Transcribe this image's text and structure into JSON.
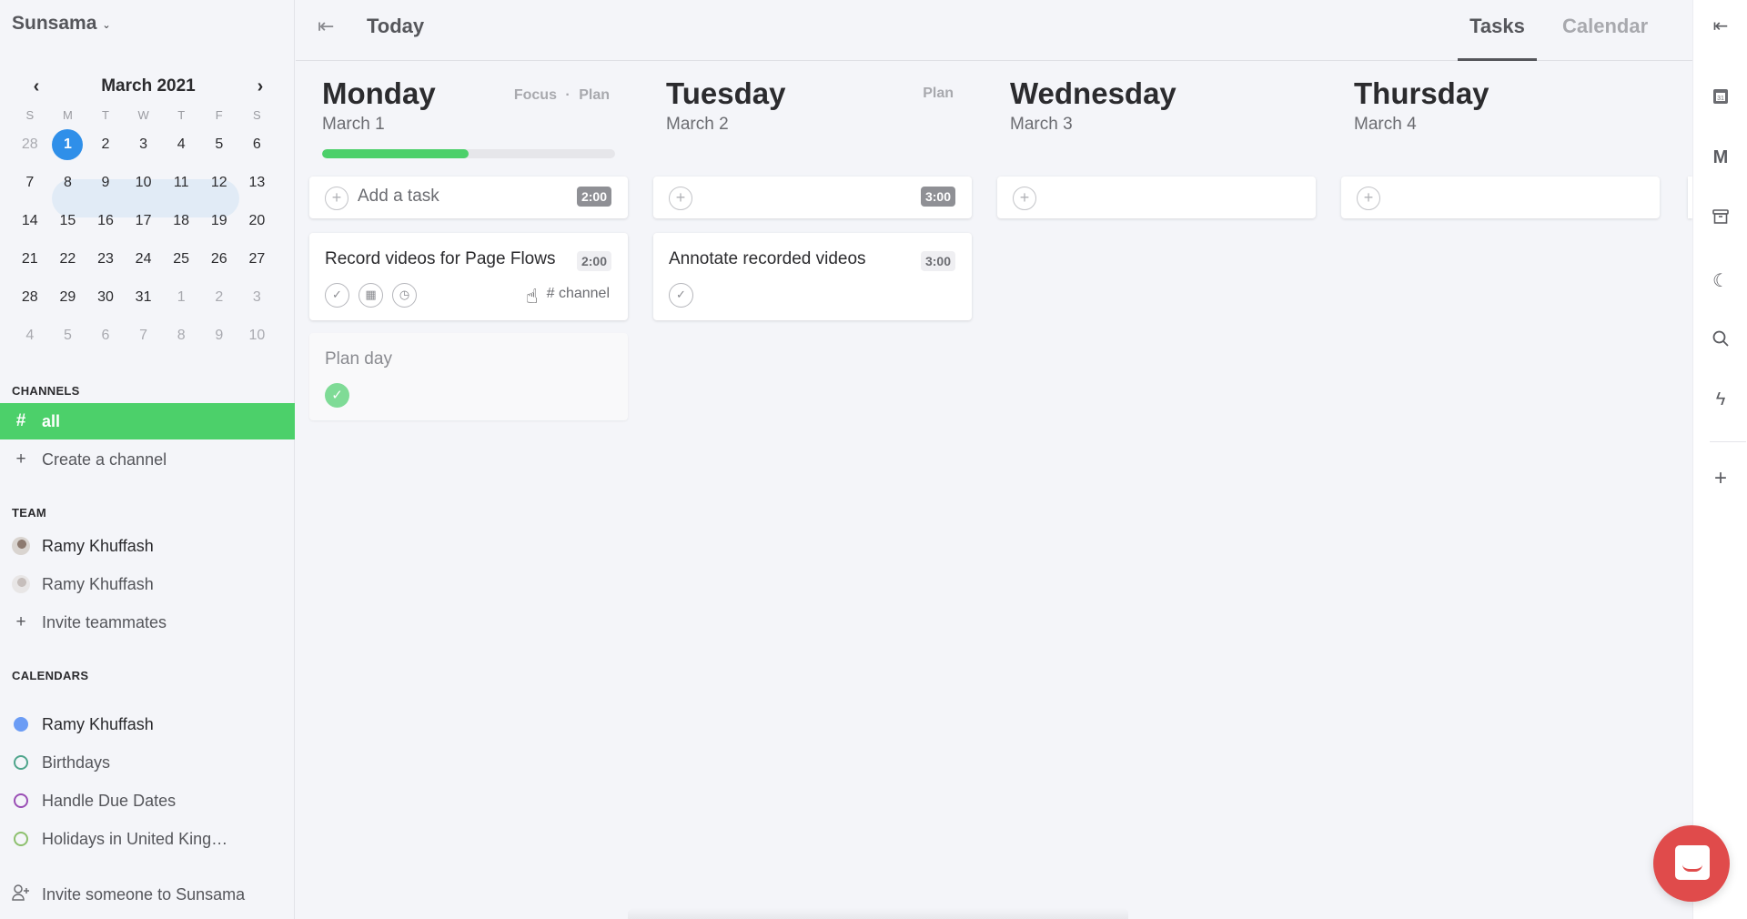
{
  "app": {
    "name": "Sunsama"
  },
  "mini_calendar": {
    "title": "March 2021",
    "prev_label": "‹",
    "next_label": "›",
    "weekdays": [
      "S",
      "M",
      "T",
      "W",
      "T",
      "F",
      "S"
    ],
    "weeks": [
      [
        {
          "d": "28",
          "m": true
        },
        {
          "d": "1",
          "sel": true
        },
        {
          "d": "2"
        },
        {
          "d": "3"
        },
        {
          "d": "4"
        },
        {
          "d": "5"
        },
        {
          "d": "6"
        }
      ],
      [
        {
          "d": "7"
        },
        {
          "d": "8"
        },
        {
          "d": "9"
        },
        {
          "d": "10"
        },
        {
          "d": "11"
        },
        {
          "d": "12"
        },
        {
          "d": "13"
        }
      ],
      [
        {
          "d": "14"
        },
        {
          "d": "15"
        },
        {
          "d": "16"
        },
        {
          "d": "17"
        },
        {
          "d": "18"
        },
        {
          "d": "19"
        },
        {
          "d": "20"
        }
      ],
      [
        {
          "d": "21"
        },
        {
          "d": "22"
        },
        {
          "d": "23"
        },
        {
          "d": "24"
        },
        {
          "d": "25"
        },
        {
          "d": "26"
        },
        {
          "d": "27"
        }
      ],
      [
        {
          "d": "28"
        },
        {
          "d": "29"
        },
        {
          "d": "30"
        },
        {
          "d": "31"
        },
        {
          "d": "1",
          "m": true
        },
        {
          "d": "2",
          "m": true
        },
        {
          "d": "3",
          "m": true
        }
      ],
      [
        {
          "d": "4",
          "m": true
        },
        {
          "d": "5",
          "m": true
        },
        {
          "d": "6",
          "m": true
        },
        {
          "d": "7",
          "m": true
        },
        {
          "d": "8",
          "m": true
        },
        {
          "d": "9",
          "m": true
        },
        {
          "d": "10",
          "m": true
        }
      ]
    ]
  },
  "sidebar": {
    "channels_title": "CHANNELS",
    "channels": [
      {
        "icon": "#",
        "label": "all"
      }
    ],
    "create_channel": "Create a channel",
    "team_title": "TEAM",
    "team": [
      {
        "label": "Ramy Khuffash"
      },
      {
        "label": "Ramy Khuffash"
      }
    ],
    "invite_teammates": "Invite teammates",
    "calendars_title": "CALENDARS",
    "calendars": [
      {
        "label": "Ramy Khuffash",
        "color": "#6b9cf5",
        "filled": true
      },
      {
        "label": "Birthdays",
        "color": "#4fa58c",
        "filled": false
      },
      {
        "label": "Handle Due Dates",
        "color": "#9a4fb5",
        "filled": false
      },
      {
        "label": "Holidays in United King…",
        "color": "#8dc06e",
        "filled": false
      }
    ],
    "invite_someone": "Invite someone to Sunsama"
  },
  "header": {
    "title": "Today",
    "tabs": [
      {
        "label": "Tasks",
        "active": true
      },
      {
        "label": "Calendar",
        "active": false
      }
    ]
  },
  "days": [
    {
      "name": "Monday",
      "date": "March 1",
      "links": [
        "Focus",
        "·",
        "Plan"
      ],
      "progress": 0.5,
      "add_label": "Add a task",
      "total_time": "2:00",
      "tasks": [
        {
          "title": "Record videos for Page Flows",
          "time": "2:00",
          "channel": "# channel"
        }
      ],
      "done_tasks": [
        {
          "title": "Plan day"
        }
      ]
    },
    {
      "name": "Tuesday",
      "date": "March 2",
      "links": [
        "Plan"
      ],
      "add_label": "",
      "total_time": "3:00",
      "tasks": [
        {
          "title": "Annotate recorded videos",
          "time": "3:00"
        }
      ]
    },
    {
      "name": "Wednesday",
      "date": "March 3",
      "links": [],
      "add_label": "",
      "total_time": ""
    },
    {
      "name": "Thursday",
      "date": "March 4",
      "links": [],
      "add_label": "",
      "total_time": ""
    }
  ],
  "colors": {
    "accent_green": "#4cd06a",
    "selected_blue": "#2f8fe9",
    "chat_red": "#e04b4b"
  }
}
